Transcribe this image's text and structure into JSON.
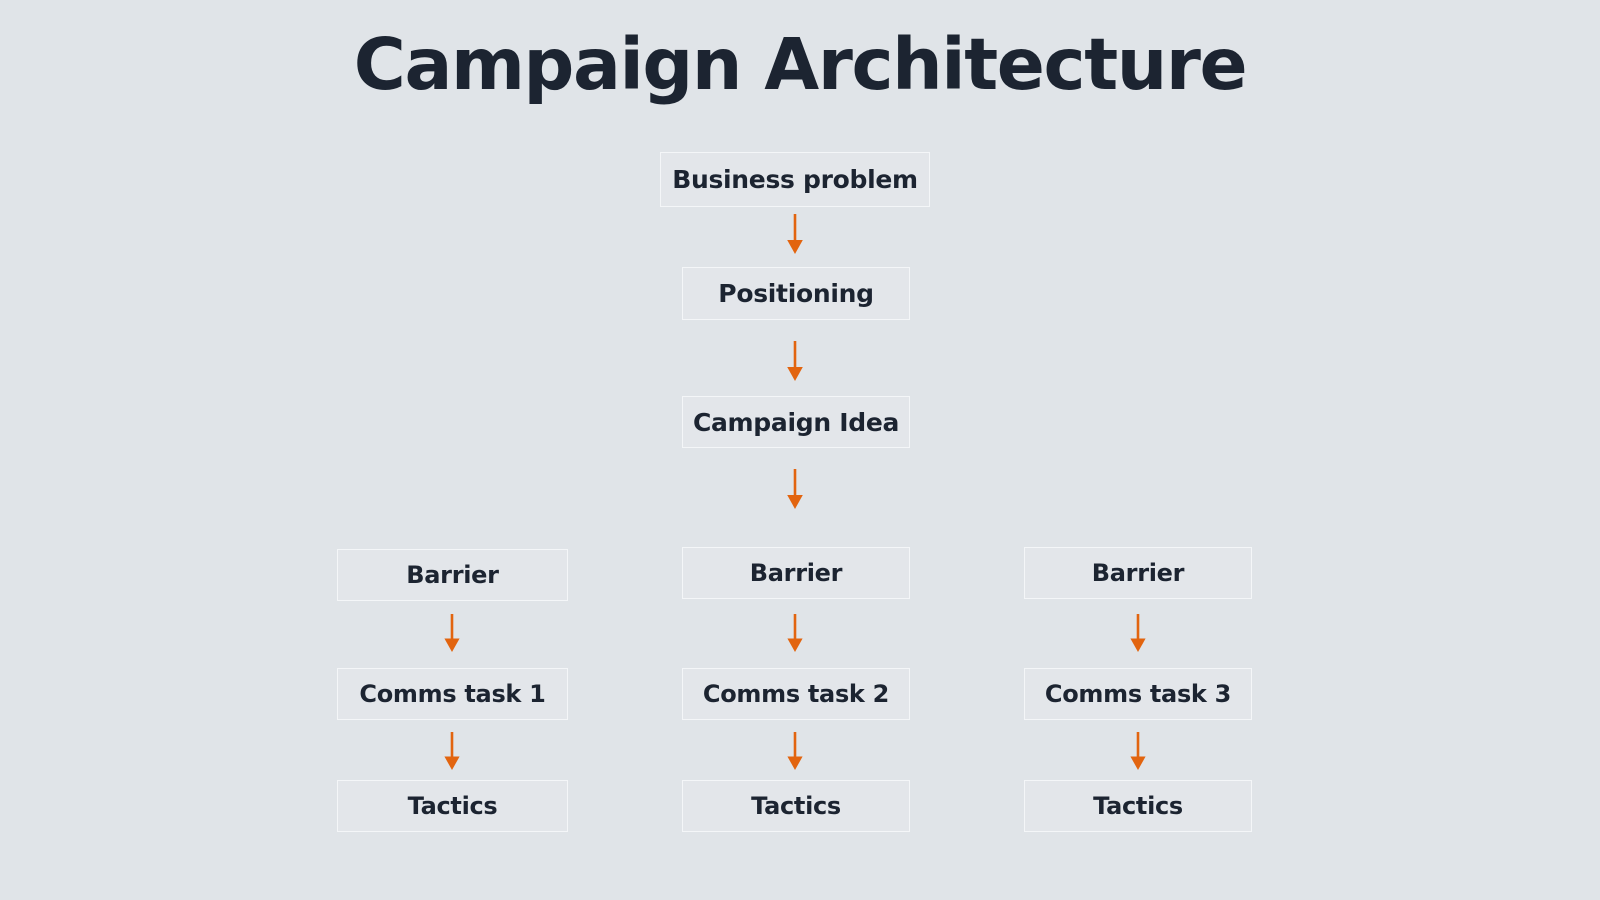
{
  "page": {
    "title": "Campaign Architecture",
    "background_color": "#e0e4e8",
    "text_color": "#1c2431",
    "arrow_color": "#e2640f",
    "box_fill_color": "#e3e6ea",
    "box_border_color": "#f4f6f8"
  },
  "diagram": {
    "type": "flowchart",
    "orientation": "top-down",
    "spine": [
      {
        "id": "business-problem",
        "label": "Business problem"
      },
      {
        "id": "positioning",
        "label": "Positioning"
      },
      {
        "id": "campaign-idea",
        "label": "Campaign Idea"
      }
    ],
    "branches": [
      {
        "id": "branch-1",
        "steps": [
          {
            "id": "barrier-1",
            "label": "Barrier"
          },
          {
            "id": "comms-task-1",
            "label": "Comms task 1"
          },
          {
            "id": "tactics-1",
            "label": "Tactics"
          }
        ]
      },
      {
        "id": "branch-2",
        "steps": [
          {
            "id": "barrier-2",
            "label": "Barrier"
          },
          {
            "id": "comms-task-2",
            "label": "Comms task 2"
          },
          {
            "id": "tactics-2",
            "label": "Tactics"
          }
        ]
      },
      {
        "id": "branch-3",
        "steps": [
          {
            "id": "barrier-3",
            "label": "Barrier"
          },
          {
            "id": "comms-task-3",
            "label": "Comms task 3"
          },
          {
            "id": "tactics-3",
            "label": "Tactics"
          }
        ]
      }
    ],
    "connectors": [
      {
        "id": "arrow-business-problem-to-positioning",
        "icon": "down-arrow-icon"
      },
      {
        "id": "arrow-positioning-to-campaign-idea",
        "icon": "down-arrow-icon"
      },
      {
        "id": "arrow-campaign-idea-to-barriers",
        "icon": "down-arrow-icon"
      },
      {
        "id": "arrow-barrier-1-to-comms-task-1",
        "icon": "down-arrow-icon"
      },
      {
        "id": "arrow-comms-task-1-to-tactics-1",
        "icon": "down-arrow-icon"
      },
      {
        "id": "arrow-barrier-2-to-comms-task-2",
        "icon": "down-arrow-icon"
      },
      {
        "id": "arrow-comms-task-2-to-tactics-2",
        "icon": "down-arrow-icon"
      },
      {
        "id": "arrow-barrier-3-to-comms-task-3",
        "icon": "down-arrow-icon"
      },
      {
        "id": "arrow-comms-task-3-to-tactics-3",
        "icon": "down-arrow-icon"
      }
    ]
  }
}
